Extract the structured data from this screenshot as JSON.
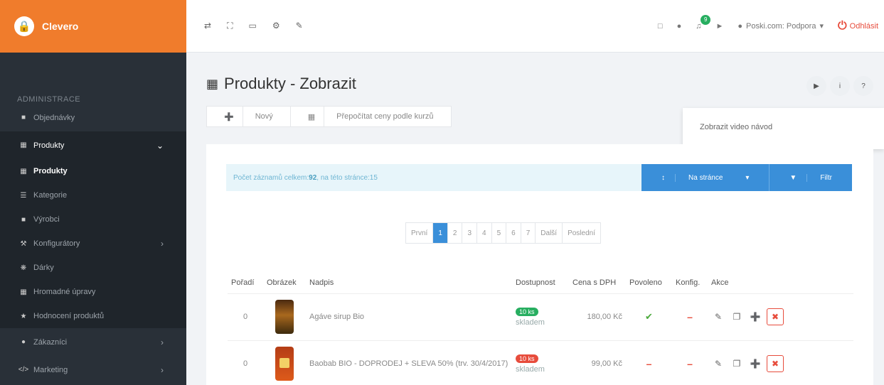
{
  "brand": {
    "name": "Clevero",
    "logo_icon": "lock-icon",
    "color": "#f07c2c"
  },
  "sidebar": {
    "section_title": "ADMINISTRACE",
    "items": [
      {
        "label": "Objednávky",
        "icon": "cart-icon"
      },
      {
        "label": "Produkty",
        "icon": "grid-icon",
        "expanded": true
      },
      {
        "label": "Produkty",
        "icon": "grid-icon",
        "current": true
      },
      {
        "label": "Kategorie",
        "icon": "list-icon"
      },
      {
        "label": "Výrobci",
        "icon": "briefcase-icon"
      },
      {
        "label": "Konfigurátory",
        "icon": "wrench-icon"
      },
      {
        "label": "Dárky",
        "icon": "gift-icon"
      },
      {
        "label": "Hromadné úpravy",
        "icon": "table-icon"
      },
      {
        "label": "Hodnocení produktů",
        "icon": "star-icon"
      },
      {
        "label": "Zákazníci",
        "icon": "user-icon"
      },
      {
        "label": "Marketing",
        "icon": "code-icon"
      }
    ]
  },
  "topbar": {
    "user_label": "Poski.com: Podpora",
    "notification_count": "9",
    "logout_label": "Odhlásit"
  },
  "page": {
    "title": "Produkty - Zobrazit",
    "actions": {
      "new_label": "Nový",
      "recalc_label": "Přepočítat ceny podle kurzů"
    },
    "tooltip": "Zobrazit video návod"
  },
  "info": {
    "prefix": "Počet záznamů celkem: ",
    "total": "92",
    "middle": ", na této stránce: ",
    "per_page": "15",
    "per_page_btn": "Na stránce",
    "filter_btn": "Filtr"
  },
  "pager": {
    "prev": "První",
    "pages": [
      "1",
      "2",
      "3",
      "4",
      "5",
      "6",
      "7"
    ],
    "current": "1",
    "next": "Další",
    "last": "Poslední"
  },
  "table": {
    "headers": {
      "order": "Pořadí",
      "image": "Obrázek",
      "title": "Nadpis",
      "availability": "Dostupnost",
      "price": "Cena s DPH",
      "enabled": "Povoleno",
      "config": "Konfig.",
      "actions": "Akce"
    },
    "rows": [
      {
        "order": "0",
        "title": "Agáve sirup Bio",
        "stock_badge": "10 ks",
        "stock_text": "skladem",
        "stock_color": "green",
        "price": "180,00 Kč",
        "enabled": "✔",
        "config": "–"
      },
      {
        "order": "0",
        "title": "Baobab BIO - DOPRODEJ + SLEVA 50% (trv. 30/4/2017)",
        "stock_badge": "10 ks",
        "stock_text": "skladem",
        "stock_color": "red",
        "price": "99,00 Kč",
        "enabled": "–",
        "config": "–"
      }
    ]
  }
}
